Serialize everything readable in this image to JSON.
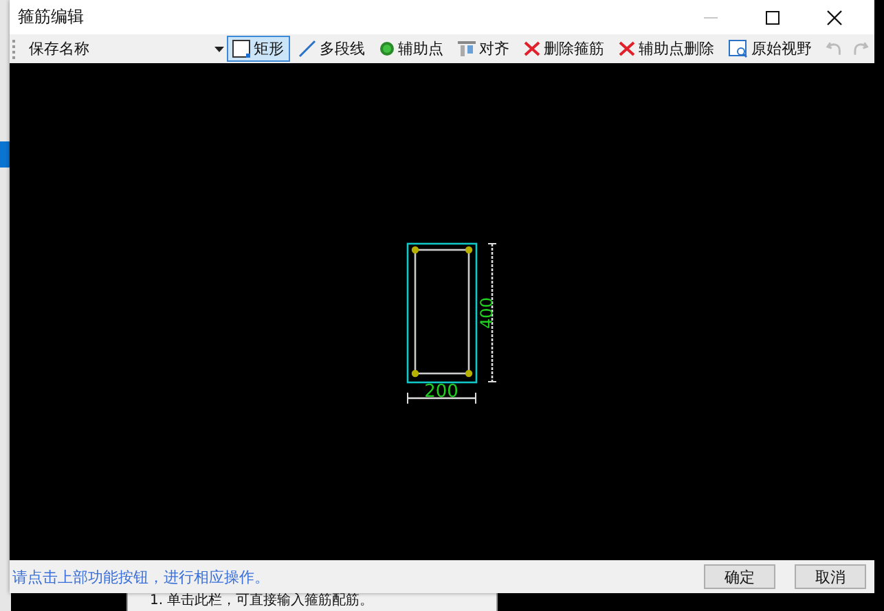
{
  "background": {
    "hint_text": "1. 单击此栏，可直接输入箍筋配筋。"
  },
  "window": {
    "title": "箍筋编辑"
  },
  "toolbar": {
    "name_field": {
      "value": "保存名称"
    },
    "tools": [
      {
        "kind": "rect",
        "label": "矩形",
        "selected": true
      },
      {
        "kind": "polyline",
        "label": "多段线",
        "selected": false
      },
      {
        "kind": "point",
        "label": "辅助点",
        "selected": false
      },
      {
        "kind": "align",
        "label": "对齐",
        "selected": false
      },
      {
        "kind": "delete",
        "label": "删除箍筋",
        "selected": false
      },
      {
        "kind": "delete",
        "label": "辅助点删除",
        "selected": false
      },
      {
        "kind": "view",
        "label": "原始视野",
        "selected": false
      }
    ]
  },
  "drawing": {
    "width_label": "200",
    "height_label": "400"
  },
  "status_bar": {
    "message": "请点击上部功能按钮，进行相应操作。",
    "buttons": [
      "确定",
      "取消"
    ]
  }
}
